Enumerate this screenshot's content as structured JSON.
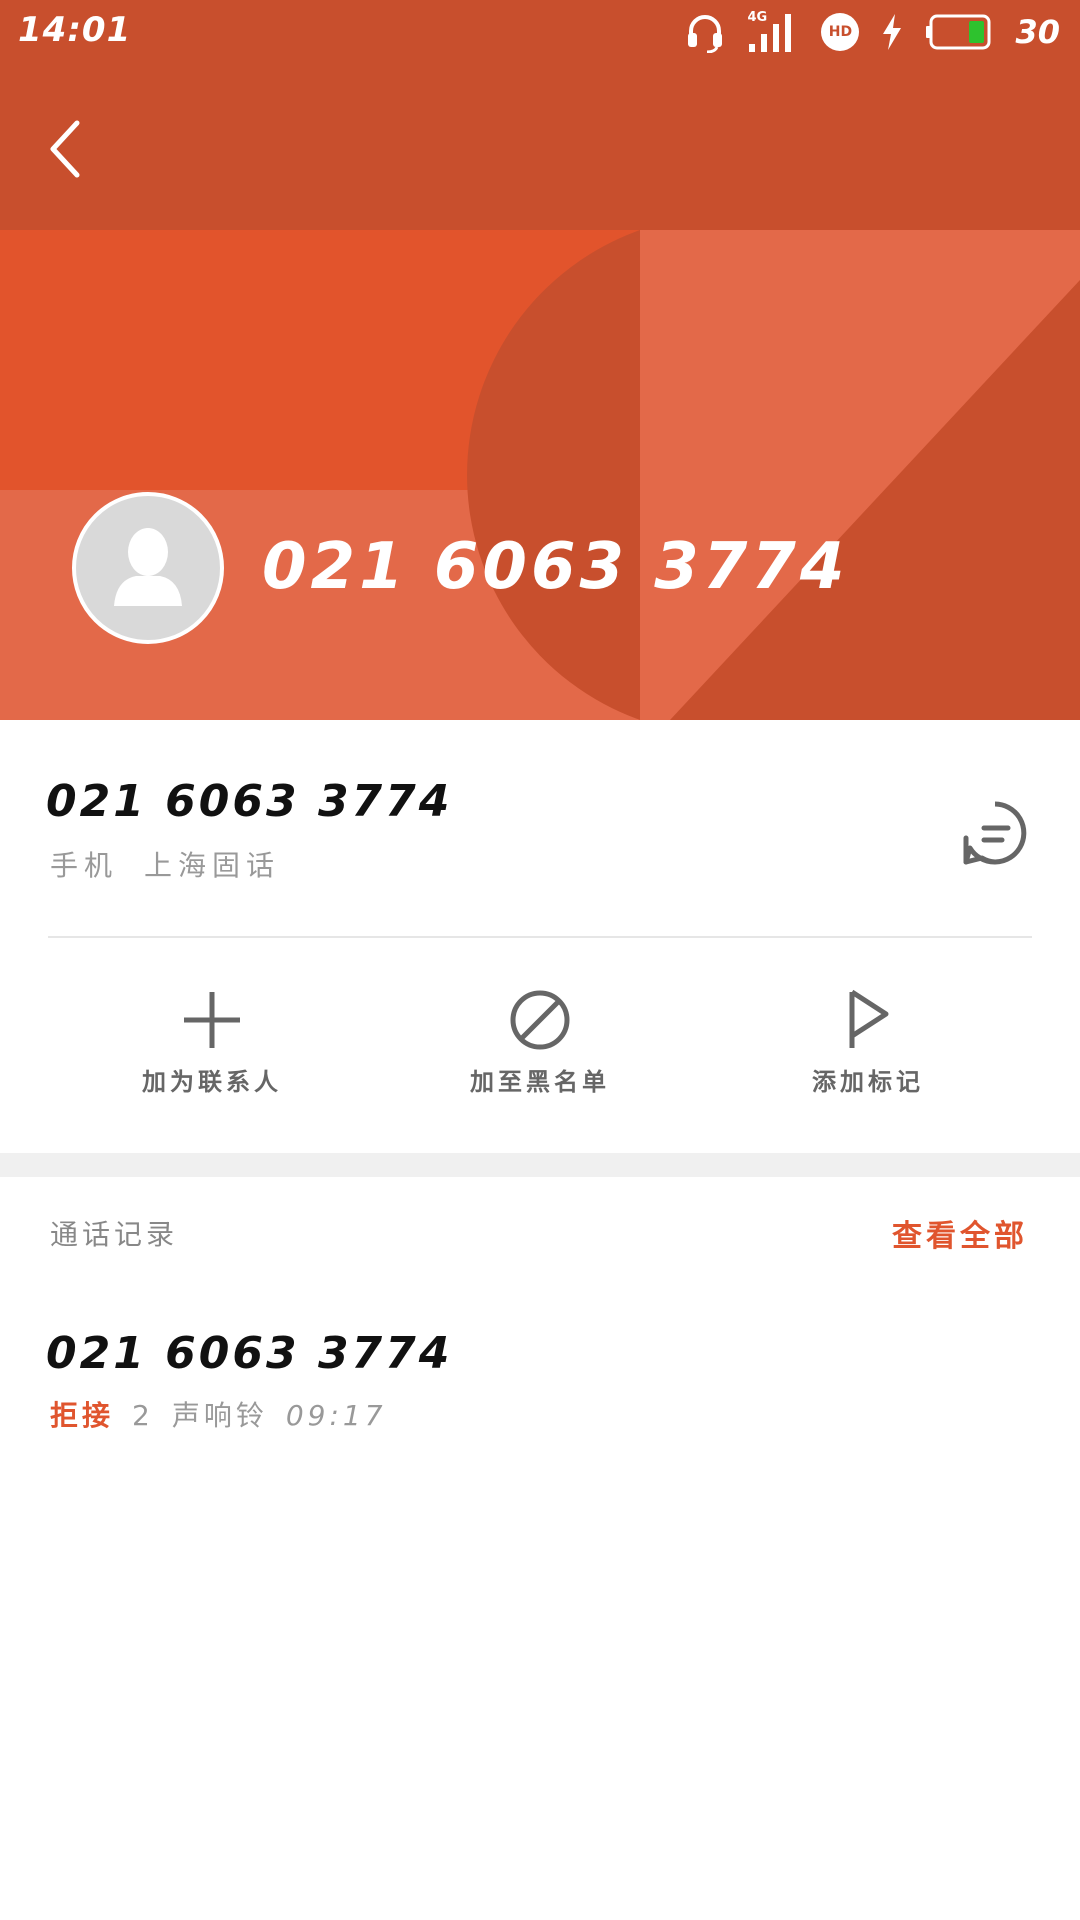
{
  "status_bar": {
    "time": "14:01",
    "network_label": "4G",
    "hd_label": "HD",
    "battery_level": "30",
    "icons": [
      "headset-icon",
      "signal-4g-icon",
      "hd-voice-icon",
      "charging-icon",
      "battery-icon"
    ]
  },
  "header": {
    "number": "021 6063 3774",
    "colors": {
      "bar": "#c84f2d",
      "accent": "#e0552e",
      "banner_light": "#e36949"
    }
  },
  "contact": {
    "number": "021 6063 3774",
    "type": "手机",
    "location": "上海固话"
  },
  "actions": [
    {
      "label": "加为联系人",
      "icon": "plus-icon"
    },
    {
      "label": "加至黑名单",
      "icon": "block-icon"
    },
    {
      "label": "添加标记",
      "icon": "flag-icon"
    }
  ],
  "call_log": {
    "title": "通话记录",
    "view_all": "查看全部",
    "items": [
      {
        "number": "021 6063 3774",
        "status": "拒接",
        "rings": "2",
        "rings_unit": "声响铃",
        "time": "09:17"
      }
    ]
  }
}
